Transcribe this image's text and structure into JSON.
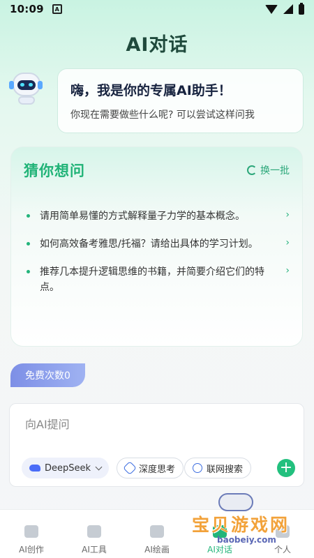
{
  "status_bar": {
    "time": "10:09",
    "notif_glyph": "A"
  },
  "header": {
    "title": "AI对话"
  },
  "greeting": {
    "title": "嗨，我是你的专属AI助手！",
    "subtitle": "你现在需要做些什么呢? 可以尝试这样问我"
  },
  "suggestions": {
    "title": "猜你想问",
    "refresh_label": "换一批",
    "items": [
      {
        "text": "请用简单易懂的方式解释量子力学的基本概念。"
      },
      {
        "text": "如何高效备考雅思/托福？请给出具体的学习计划。"
      },
      {
        "text": "推荐几本提升逻辑思维的书籍，并简要介绍它们的特点。"
      }
    ]
  },
  "free_quota": {
    "label": "免费次数0"
  },
  "composer": {
    "placeholder": "向AI提问",
    "model_label": "DeepSeek",
    "deep_think_label": "深度思考",
    "web_search_label": "联网搜索",
    "add_symbol": "+"
  },
  "tabbar": {
    "tabs": [
      {
        "label": "AI创作"
      },
      {
        "label": "AI工具"
      },
      {
        "label": "AI绘画"
      },
      {
        "label": "AI对话"
      },
      {
        "label": "个人"
      }
    ]
  },
  "watermark": {
    "title": "宝贝游戏网",
    "url": "baobeiy.com"
  },
  "colors": {
    "accent": "#22b57a",
    "badge": "#8a9cec",
    "icon_blue": "#3c6de0"
  }
}
